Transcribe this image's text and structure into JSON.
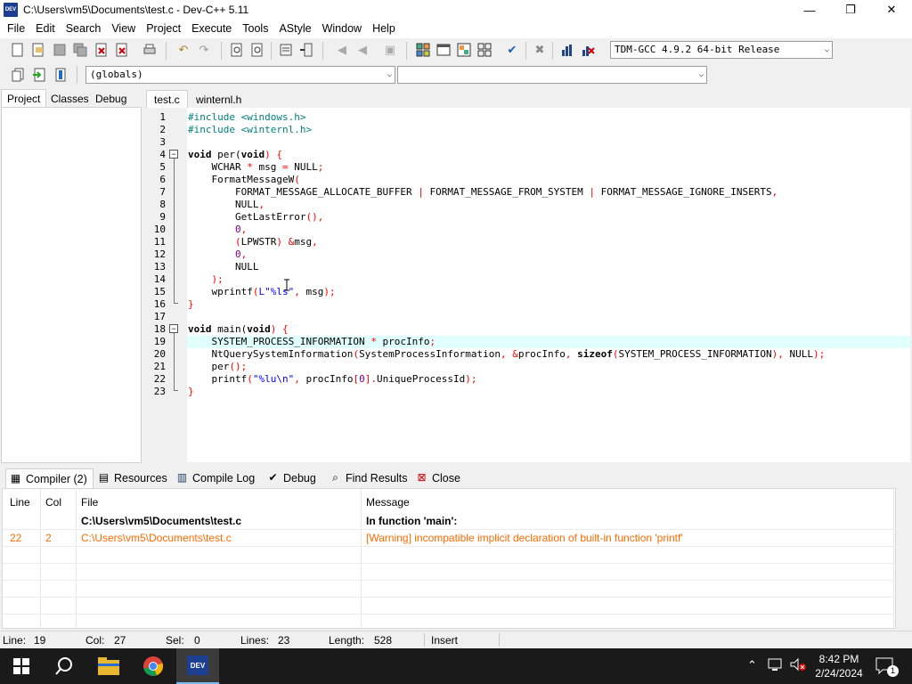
{
  "window": {
    "title": "C:\\Users\\vm5\\Documents\\test.c - Dev-C++ 5.11",
    "app_icon_text": "DEV",
    "minimize": "—",
    "restore": "❐",
    "close": "✕"
  },
  "menu": [
    "File",
    "Edit",
    "Search",
    "View",
    "Project",
    "Execute",
    "Tools",
    "AStyle",
    "Window",
    "Help"
  ],
  "toolbar": {
    "compiler_select": "TDM-GCC 4.9.2 64-bit Release",
    "scope_select": "(globals)",
    "function_select": ""
  },
  "left_panel": {
    "tabs": [
      "Project",
      "Classes",
      "Debug"
    ]
  },
  "editor": {
    "tabs": [
      "test.c",
      "winternl.h"
    ],
    "current_line": 19,
    "line_numbers": [
      "1",
      "2",
      "3",
      "4",
      "5",
      "6",
      "7",
      "8",
      "9",
      "10",
      "11",
      "12",
      "13",
      "14",
      "15",
      "16",
      "17",
      "18",
      "19",
      "20",
      "21",
      "22",
      "23"
    ],
    "code": {
      "l1_a": "#include <windows.h>",
      "l2_a": "#include <winternl.h>",
      "l4_a": "void",
      "l4_b": " per(",
      "l4_c": "void",
      "l4_d": ") ",
      "l4_e": "{",
      "l5_a": "    WCHAR ",
      "l5_b": "*",
      "l5_c": " msg ",
      "l5_d": "=",
      "l5_e": " NULL",
      "l5_f": ";",
      "l6_a": "    FormatMessageW",
      "l6_b": "(",
      "l7_a": "        FORMAT_MESSAGE_ALLOCATE_BUFFER ",
      "l7_b": "|",
      "l7_c": " FORMAT_MESSAGE_FROM_SYSTEM ",
      "l7_d": "|",
      "l7_e": " FORMAT_MESSAGE_IGNORE_INSERTS",
      "l7_f": ",",
      "l8_a": "        NULL",
      "l8_b": ",",
      "l9_a": "        GetLastError",
      "l9_b": "(),",
      "l10_a": "        ",
      "l10_b": "0",
      "l10_c": ",",
      "l11_a": "        ",
      "l11_b": "(",
      "l11_c": "LPWSTR",
      "l11_d": ") ",
      "l11_e": "&",
      "l11_f": "msg",
      "l11_g": ",",
      "l12_a": "        ",
      "l12_b": "0",
      "l12_c": ",",
      "l13_a": "        NULL",
      "l14_a": "    ",
      "l14_b": ");",
      "l15_a": "    wprintf",
      "l15_b": "(",
      "l15_c": "L\"%ls\"",
      "l15_d": ",",
      "l15_e": " msg",
      "l15_f": ");",
      "l16_a": "}",
      "l18_a": "void",
      "l18_b": " main(",
      "l18_c": "void",
      "l18_d": ") ",
      "l18_e": "{",
      "l19_a": "    SYSTEM_PROCESS_INFORMATION ",
      "l19_b": "*",
      "l19_c": " procInfo",
      "l19_d": ";",
      "l20_a": "    NtQuerySystemInformation",
      "l20_b": "(",
      "l20_c": "SystemProcessInformation",
      "l20_d": ",",
      "l20_e": " ",
      "l20_f": "&",
      "l20_g": "procInfo",
      "l20_h": ",",
      "l20_i": " sizeof",
      "l20_j": "(",
      "l20_k": "SYSTEM_PROCESS_INFORMATION",
      "l20_l": "),",
      "l20_m": " NULL",
      "l20_n": ");",
      "l21_a": "    per",
      "l21_b": "();",
      "l22_a": "    printf",
      "l22_b": "(",
      "l22_c": "\"%lu\\n\"",
      "l22_d": ",",
      "l22_e": " procInfo",
      "l22_f": "[",
      "l22_g": "0",
      "l22_h": "].",
      "l22_i": "UniqueProcessId",
      "l22_j": ");",
      "l23_a": "}"
    }
  },
  "bottom_tabs": [
    "Compiler (2)",
    "Resources",
    "Compile Log",
    "Debug",
    "Find Results",
    "Close"
  ],
  "results": {
    "headers": [
      "Line",
      "Col",
      "File",
      "Message"
    ],
    "rows": [
      {
        "line": "",
        "col": "",
        "file": "C:\\Users\\vm5\\Documents\\test.c",
        "message": "In function 'main':"
      },
      {
        "line": "22",
        "col": "2",
        "file": "C:\\Users\\vm5\\Documents\\test.c",
        "message": "[Warning] incompatible implicit declaration of built-in function 'printf'"
      }
    ]
  },
  "status": {
    "line_label": "Line:",
    "line_value": "19",
    "col_label": "Col:",
    "col_value": "27",
    "sel_label": "Sel:",
    "sel_value": "0",
    "lines_label": "Lines:",
    "lines_value": "23",
    "length_label": "Length:",
    "length_value": "528",
    "mode": "Insert"
  },
  "taskbar": {
    "time": "8:42 PM",
    "date": "2/24/2024",
    "notification_count": "1",
    "active_app_text": "DEV"
  },
  "colors": {
    "keyword": "#000000",
    "preprocessor": "#008080",
    "string": "#0000ff",
    "number": "#800080",
    "symbol": "#ff0000",
    "warning": "#ff6a00",
    "current_line": "#e0ffff"
  }
}
